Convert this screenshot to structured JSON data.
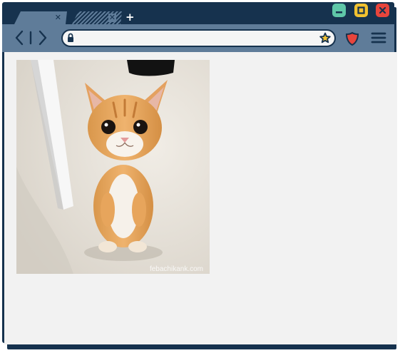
{
  "browser": {
    "tabs": [
      {
        "label": "",
        "active": true,
        "close_glyph": "✕"
      },
      {
        "label": "",
        "active": false,
        "close_glyph": "✕"
      }
    ],
    "new_tab_glyph": "+",
    "window_controls": {
      "minimize_color": "#5fc7a8",
      "maximize_color": "#f2c230",
      "close_color": "#e8453c"
    },
    "address_bar": {
      "value": "",
      "placeholder": ""
    },
    "theme": {
      "frame": "#16324e",
      "toolbar": "#5f7c99",
      "content": "#f2f2f2",
      "shield": "#e8453c"
    }
  },
  "page": {
    "image": {
      "alt": "kitten standing on hind legs",
      "watermark": "febachikank.com"
    }
  }
}
